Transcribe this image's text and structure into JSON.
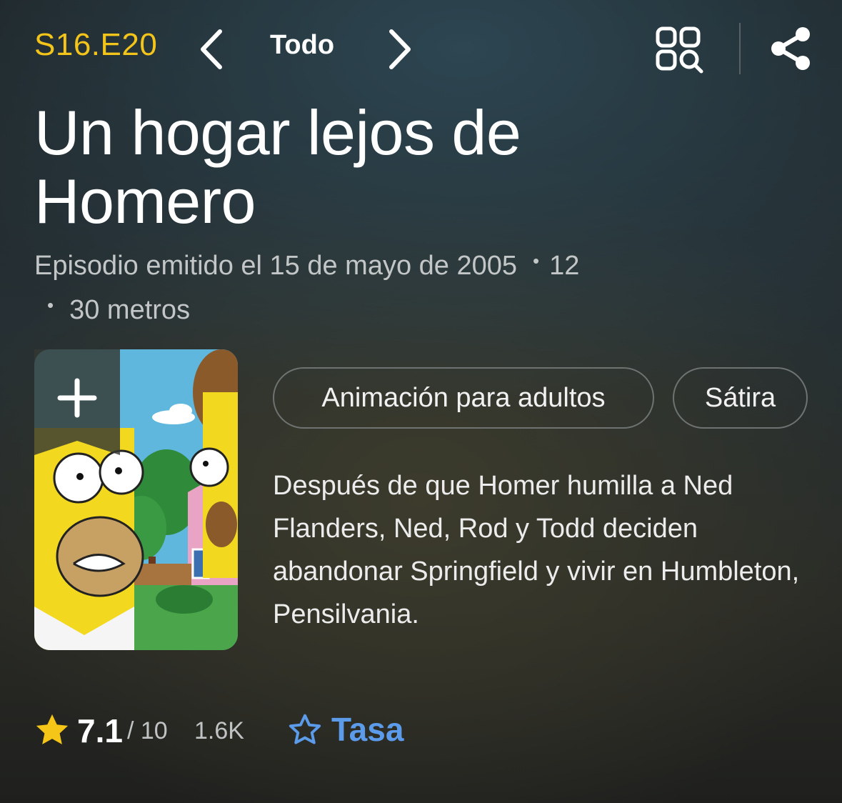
{
  "header": {
    "episode_code": "S16.E20",
    "nav_label": "Todo",
    "icons": [
      "chevron-left-icon",
      "chevron-right-icon",
      "browse-search-icon",
      "share-icon"
    ]
  },
  "episode": {
    "title": "Un hogar lejos de Homero",
    "air_date": "Episodio emitido el 15 de mayo de 2005",
    "age_rating": "12",
    "runtime": "30 metros"
  },
  "genres": [
    "Animación para adultos",
    "Sátira"
  ],
  "plot": "Después de que Homer humilla a Ned Flanders, Ned, Rod y Todd deciden abandonar Springfield y vivir en Humbleton, Pensilvania.",
  "rating": {
    "value": "7.1",
    "max": "/ 10",
    "count": "1.6K",
    "rate_label": "Tasa"
  },
  "colors": {
    "episode_code": "#f3c41a",
    "star": "#f5c518",
    "rate_link": "#5b9bea",
    "secondary_text": "#c3c6c6"
  }
}
